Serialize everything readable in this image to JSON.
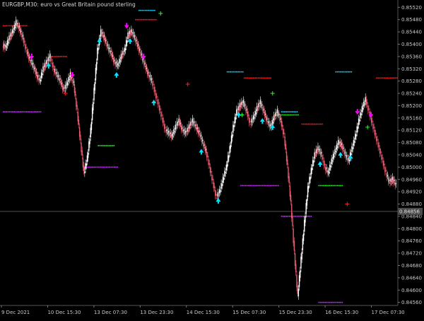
{
  "window": {
    "symbol": "EURGBP",
    "timeframe": "M30",
    "title": "EURGBP,M30:  euro vs Great Britain pound sterling"
  },
  "colors": {
    "background": "#000000",
    "bull_candle": "#ffffff",
    "bear_candle": "#e65a6f",
    "buy_marker": "#00e5ff",
    "sell_marker": "#ff00ff",
    "dot_red": "#ff2020",
    "dot_green": "#22ff22",
    "dot_cyan": "#2ad4ff",
    "dot_magenta": "#cc33ff",
    "axis_text": "#c8c8c8",
    "grid_line": "#6b6b6b"
  },
  "chart_data": {
    "type": "candlestick",
    "title": "EURGBP,M30:  euro vs Great Britain pound sterling",
    "ylim": [
      0.8455,
      0.8553
    ],
    "y_ticks": [
      "0.85520",
      "0.85480",
      "0.85440",
      "0.85400",
      "0.85360",
      "0.85320",
      "0.85280",
      "0.85240",
      "0.85200",
      "0.85160",
      "0.85120",
      "0.85080",
      "0.85040",
      "0.85000",
      "0.84960",
      "0.84920",
      "0.84880",
      "0.84840",
      "0.84800",
      "0.84760",
      "0.84720",
      "0.84680",
      "0.84640",
      "0.84600",
      "0.84560"
    ],
    "x_ticks": [
      "9 Dec 2021",
      "10 Dec 15:30",
      "13 Dec 07:30",
      "13 Dec 23:30",
      "14 Dec 15:30",
      "15 Dec 07:30",
      "15 Dec 23:30",
      "16 Dec 15:30",
      "17 Dec 07:30"
    ],
    "current_price": "0.84856",
    "price_path": [
      0.8539,
      0.8542,
      0.8544,
      0.8547,
      0.8545,
      0.8542,
      0.8538,
      0.8535,
      0.8533,
      0.853,
      0.8528,
      0.8532,
      0.8534,
      0.8536,
      0.8532,
      0.853,
      0.8528,
      0.8525,
      0.8527,
      0.853,
      0.8527,
      0.8518,
      0.8508,
      0.8498,
      0.8503,
      0.8512,
      0.8525,
      0.8538,
      0.8544,
      0.8542,
      0.8539,
      0.8537,
      0.8534,
      0.8533,
      0.8536,
      0.8538,
      0.8543,
      0.8544,
      0.8542,
      0.8539,
      0.8536,
      0.8533,
      0.853,
      0.8528,
      0.8524,
      0.852,
      0.8516,
      0.8512,
      0.8511,
      0.851,
      0.8513,
      0.8515,
      0.8512,
      0.8511,
      0.8513,
      0.8515,
      0.8513,
      0.8511,
      0.8508,
      0.8505,
      0.85,
      0.8495,
      0.849,
      0.8492,
      0.8496,
      0.85,
      0.8506,
      0.8513,
      0.8518,
      0.852,
      0.8521,
      0.8518,
      0.8514,
      0.8516,
      0.8519,
      0.8521,
      0.8518,
      0.8515,
      0.8513,
      0.8516,
      0.8518,
      0.8515,
      0.851,
      0.85,
      0.8488,
      0.8472,
      0.8458,
      0.847,
      0.8482,
      0.8493,
      0.8499,
      0.8504,
      0.8506,
      0.8504,
      0.85,
      0.8498,
      0.8502,
      0.8505,
      0.8508,
      0.8507,
      0.8504,
      0.8502,
      0.8506,
      0.851,
      0.8515,
      0.8519,
      0.8522,
      0.8518,
      0.8514,
      0.851,
      0.8506,
      0.8502,
      0.8498,
      0.8495,
      0.8496,
      0.8494
    ],
    "sell_signal_indices": [
      8,
      20,
      36,
      41,
      104,
      108
    ],
    "buy_signal_indices": [
      13,
      28,
      33,
      37,
      44,
      58,
      63,
      69,
      76,
      79,
      93,
      99,
      102
    ],
    "dot_segments": [
      {
        "color": "dot_red",
        "from": 0,
        "to": 6,
        "price": 0.8546
      },
      {
        "color": "dot_red",
        "from": 14,
        "to": 18,
        "price": 0.8536
      },
      {
        "color": "dot_red",
        "from": 39,
        "to": 44,
        "price": 0.8548
      },
      {
        "color": "dot_red",
        "from": 71,
        "to": 78,
        "price": 0.8529
      },
      {
        "color": "dot_red",
        "from": 88,
        "to": 93,
        "price": 0.8514
      },
      {
        "color": "dot_red",
        "from": 110,
        "to": 115,
        "price": 0.8529
      },
      {
        "color": "dot_cyan",
        "from": 40,
        "to": 44,
        "price": 0.8551
      },
      {
        "color": "dot_cyan",
        "from": 66,
        "to": 70,
        "price": 0.8531
      },
      {
        "color": "dot_cyan",
        "from": 82,
        "to": 86,
        "price": 0.8518
      },
      {
        "color": "dot_cyan",
        "from": 98,
        "to": 102,
        "price": 0.8531
      },
      {
        "color": "dot_green",
        "from": 28,
        "to": 32,
        "price": 0.8507
      },
      {
        "color": "dot_green",
        "from": 93,
        "to": 99,
        "price": 0.8494
      },
      {
        "color": "dot_green",
        "from": 80,
        "to": 86,
        "price": 0.8517
      },
      {
        "color": "dot_magenta",
        "from": 0,
        "to": 10,
        "price": 0.8518
      },
      {
        "color": "dot_magenta",
        "from": 24,
        "to": 33,
        "price": 0.85
      },
      {
        "color": "dot_magenta",
        "from": 70,
        "to": 80,
        "price": 0.8494
      },
      {
        "color": "dot_magenta",
        "from": 82,
        "to": 90,
        "price": 0.8484
      },
      {
        "color": "dot_magenta",
        "from": 93,
        "to": 99,
        "price": 0.8456
      }
    ],
    "cross_markers": [
      {
        "index": 9,
        "price": 0.8532,
        "color": "dot_red"
      },
      {
        "index": 18,
        "price": 0.8524,
        "color": "dot_red"
      },
      {
        "index": 46,
        "price": 0.855,
        "color": "dot_green"
      },
      {
        "index": 54,
        "price": 0.8527,
        "color": "dot_red"
      },
      {
        "index": 70,
        "price": 0.8517,
        "color": "dot_green"
      },
      {
        "index": 79,
        "price": 0.8524,
        "color": "dot_green"
      },
      {
        "index": 101,
        "price": 0.8488,
        "color": "dot_red"
      },
      {
        "index": 107,
        "price": 0.8513,
        "color": "dot_green"
      }
    ]
  }
}
